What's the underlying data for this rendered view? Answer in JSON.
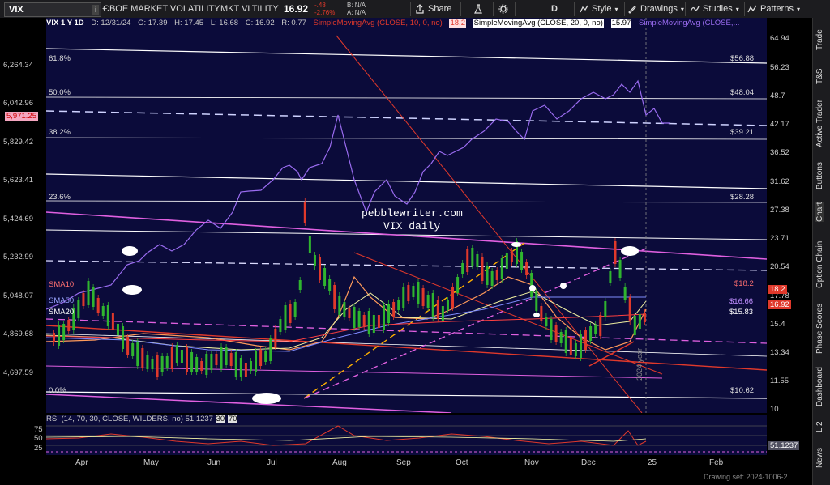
{
  "toolbar": {
    "symbol": "VIX",
    "symbol_info": "i",
    "name": "CBOE MARKET VOLATILITY",
    "short_name": "MKT VLTILITY",
    "last": "16.92",
    "change": "-.48",
    "change_pct": "-2.76%",
    "bid": "B: N/A",
    "ask": "A: N/A",
    "share": "Share",
    "timeframe": "D",
    "style": "Style",
    "drawings": "Drawings",
    "studies": "Studies",
    "patterns": "Patterns"
  },
  "header": {
    "series": "VIX 1 Y 1D",
    "date": "D: 12/31/24",
    "open": "O: 17.39",
    "high": "H: 17.45",
    "low": "L: 16.68",
    "close": "C: 16.92",
    "range": "R: 0.77",
    "sma10": "SimpleMovingAvg (CLOSE, 10, 0, no)",
    "sma10_val": "18.2",
    "sma20": "SimpleMovingAvg (CLOSE, 20, 0, no)",
    "sma20_val": "15.97",
    "sma_more": "SimpleMovingAvg (CLOSE,..."
  },
  "left_axis": [
    "6,264.34",
    "6,042.96",
    "5,971.25",
    "5,829.42",
    "5,623.41",
    "5,424.69",
    "5,232.99",
    "5,048.07",
    "4,869.68",
    "4,697.59"
  ],
  "right_axis": [
    "64.94",
    "56.23",
    "48.7",
    "42.17",
    "36.52",
    "31.62",
    "27.38",
    "23.71",
    "20.54",
    "17.78",
    "15.4",
    "13.34",
    "11.55",
    "10"
  ],
  "fib": {
    "f618": "61.8%",
    "f50": "50.0%",
    "f382": "38.2%",
    "f236": "23.6%",
    "f0": "0.0%",
    "v1": "$56.88",
    "v2": "$48.04",
    "v3": "$39.21",
    "v4": "$28.28",
    "v5": "$10.62"
  },
  "sma_labels": {
    "sma10": "SMA10",
    "sma50": "SMA50",
    "sma20": "SMA20",
    "v182": "$18.2",
    "v1666": "$16.66",
    "v1583": "$15.83"
  },
  "tags": {
    "t1": "18.2",
    "t2": "16.92"
  },
  "watermark": {
    "line1": "pebblewriter.com",
    "line2": "VIX daily"
  },
  "year_marker": "2024 year",
  "rsi": {
    "label": "RSI (14, 70, 30, CLOSE, WILDERS, no)",
    "value": "51.1237",
    "ob": "30",
    "os": "70",
    "levels": [
      "75",
      "50",
      "25"
    ],
    "tag": "51.1237"
  },
  "xaxis": [
    "Apr",
    "May",
    "Jun",
    "Jul",
    "Aug",
    "Sep",
    "Oct",
    "Nov",
    "Dec",
    "25",
    "Feb"
  ],
  "footer_note": "Drawing set: 2024-1006-2",
  "sidebar": [
    "Trade",
    "T&S",
    "Active Trader",
    "Buttons",
    "Chart",
    "Option Chain",
    "Phase Scores",
    "Dashboard",
    "L 2",
    "News"
  ],
  "colors": {
    "bg": "#0b0b3a",
    "up": "#2fb52f",
    "down": "#e0392b",
    "sma_purple": "#9a6cf0",
    "trend_pink": "#e060e0"
  }
}
